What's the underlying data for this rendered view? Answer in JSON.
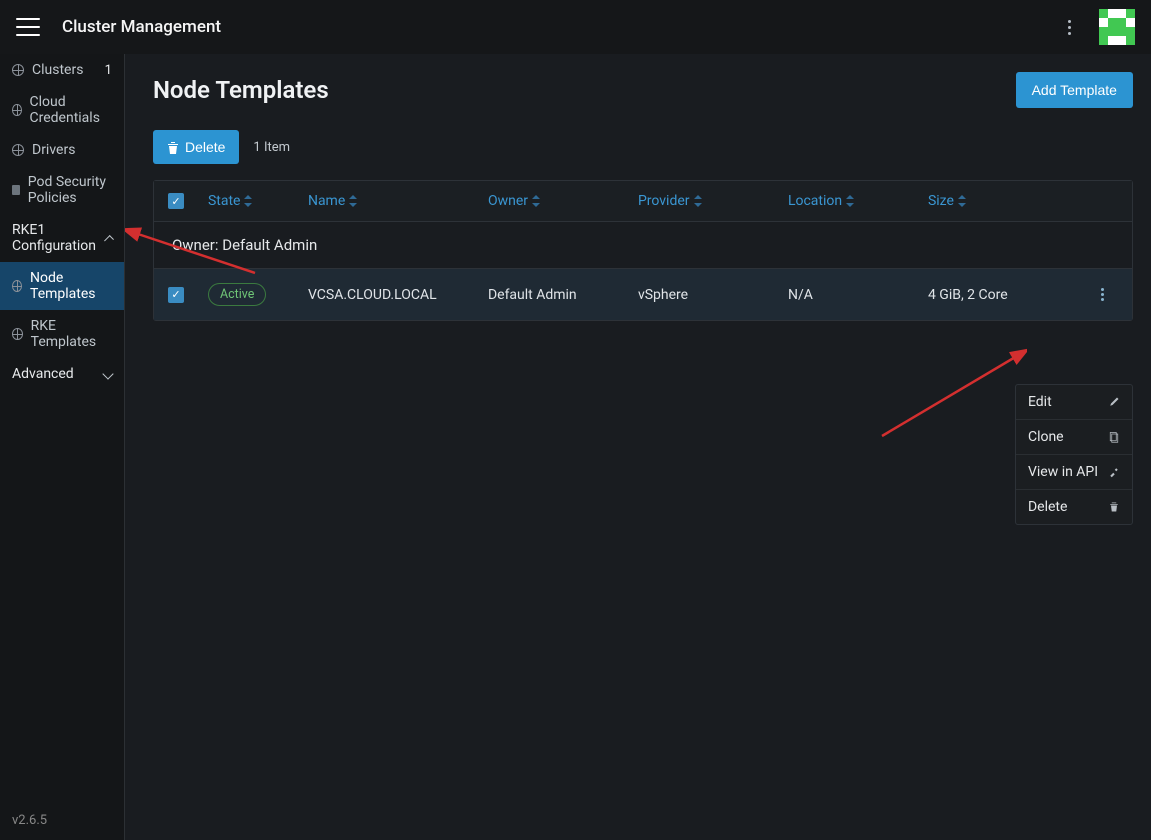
{
  "header": {
    "app_title": "Cluster Management"
  },
  "sidebar": {
    "items": [
      {
        "label": "Clusters",
        "count": "1"
      },
      {
        "label": "Cloud Credentials"
      },
      {
        "label": "Drivers"
      },
      {
        "label": "Pod Security Policies"
      }
    ],
    "section1": {
      "label": "RKE1 Configuration"
    },
    "sub_items": [
      {
        "label": "Node Templates"
      },
      {
        "label": "RKE Templates"
      }
    ],
    "section2": {
      "label": "Advanced"
    },
    "version": "v2.6.5"
  },
  "page": {
    "title": "Node Templates",
    "add_button": "Add Template",
    "delete_button": "Delete",
    "item_count": "1 Item"
  },
  "table": {
    "headers": {
      "state": "State",
      "name": "Name",
      "owner": "Owner",
      "provider": "Provider",
      "location": "Location",
      "size": "Size"
    },
    "owner_group": "Owner: Default Admin",
    "row": {
      "state": "Active",
      "name": "VCSA.CLOUD.LOCAL",
      "owner": "Default Admin",
      "provider": "vSphere",
      "location": "N/A",
      "size": "4 GiB, 2 Core"
    }
  },
  "context_menu": {
    "edit": "Edit",
    "clone": "Clone",
    "view_api": "View in API",
    "delete": "Delete"
  }
}
